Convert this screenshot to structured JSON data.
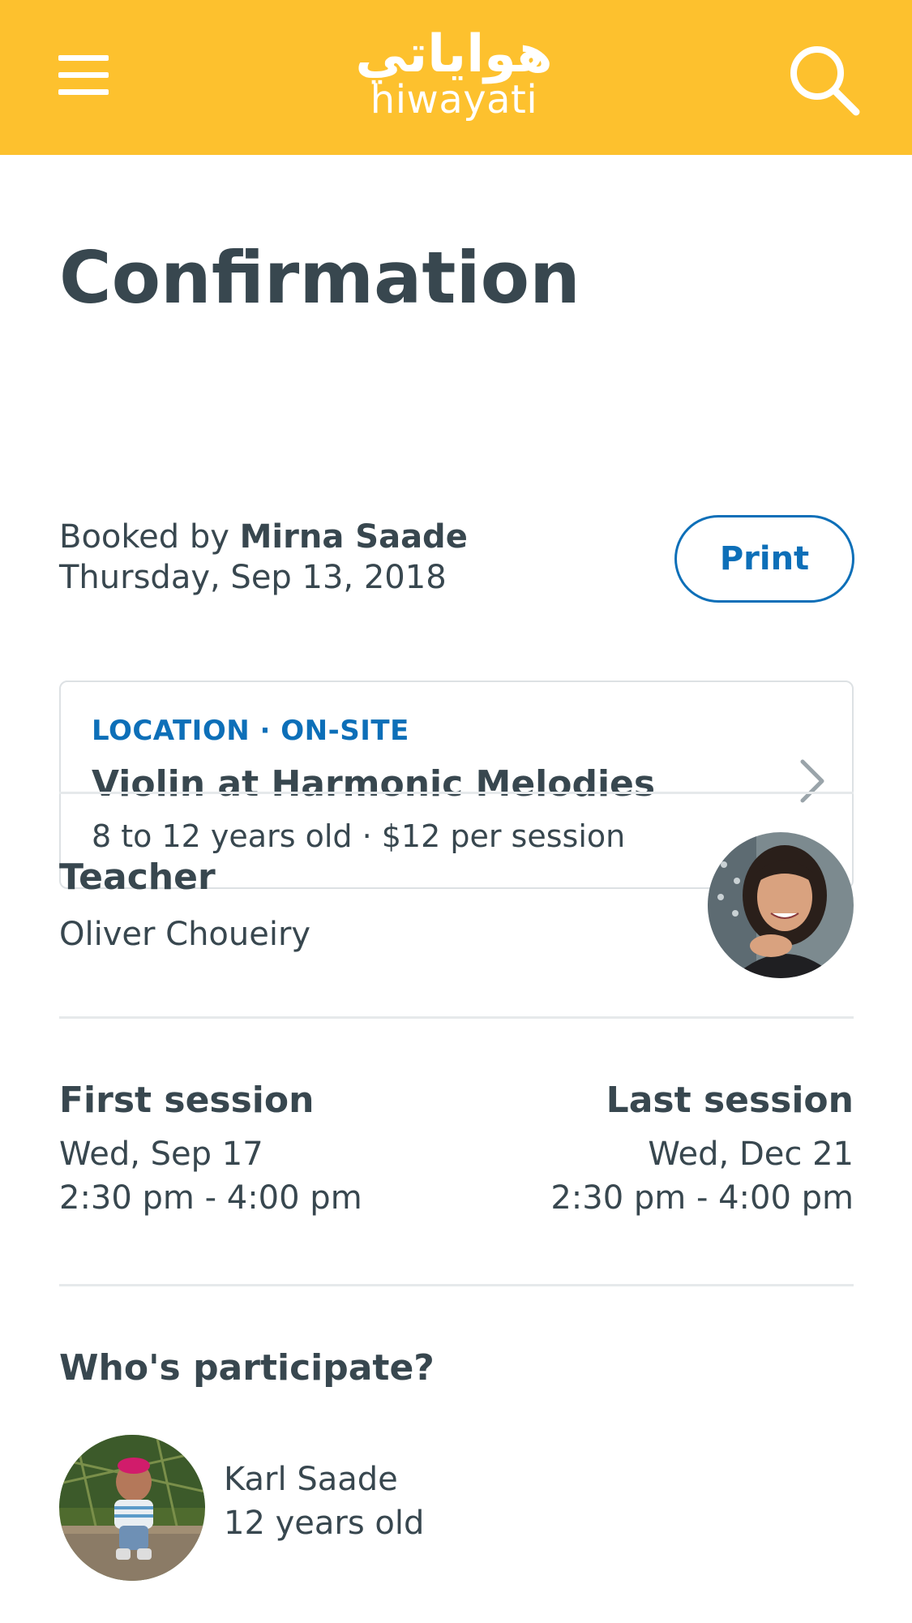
{
  "header": {
    "logo_arabic": "هواياتي",
    "logo_latin": "hiwayati",
    "menu_icon": "hamburger-menu-icon",
    "search_icon": "search-icon",
    "bar_color": "#fdc12e"
  },
  "page": {
    "title": "Confirmation",
    "booked_prefix": "Booked by",
    "booked_name": "Mirna Saade",
    "booked_date": "Thursday, Sep 13, 2018",
    "print_label": "Print"
  },
  "activity": {
    "kicker": "LOCATION · ON-SITE",
    "title": "Violin at Harmonic Melodies",
    "subtitle": "8 to 12 years old · $12 per session",
    "chevron_icon": "chevron-right-icon"
  },
  "teacher": {
    "heading": "Teacher",
    "name": "Oliver Choueiry"
  },
  "sessions": {
    "first_heading": "First session",
    "first_date": "Wed, Sep 17",
    "first_time": "2:30 pm - 4:00 pm",
    "last_heading": "Last session",
    "last_date": "Wed, Dec 21",
    "last_time": "2:30 pm - 4:00 pm"
  },
  "participants": {
    "heading": "Who's participate?",
    "items": [
      {
        "name": "Karl Saade",
        "age": "12 years old"
      }
    ]
  },
  "colors": {
    "accent": "#0d6fb8",
    "text": "#38474f",
    "divider": "#e6e9eb"
  }
}
